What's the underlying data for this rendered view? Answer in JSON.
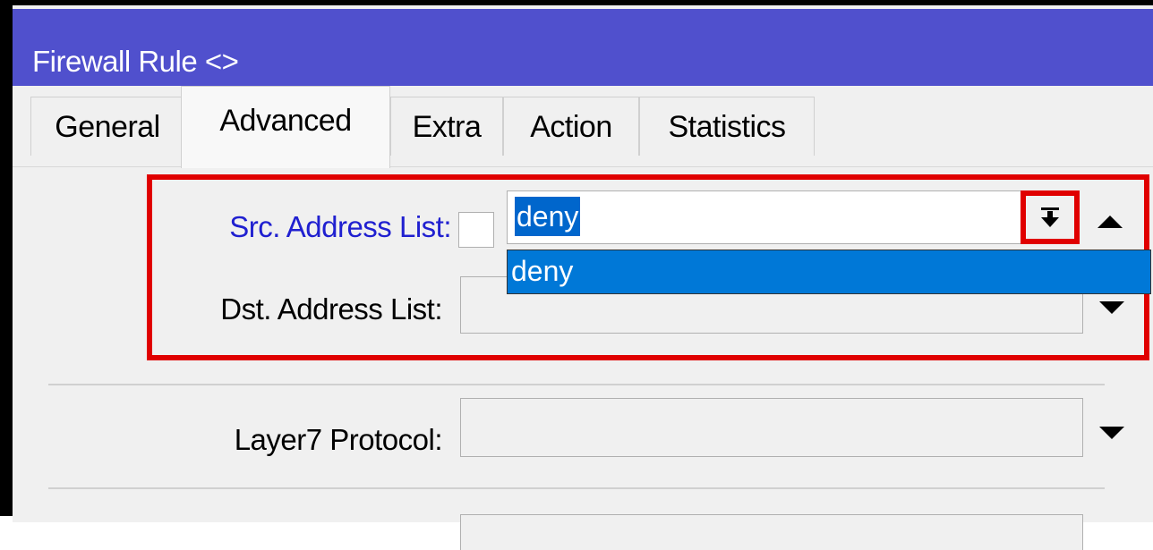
{
  "window": {
    "title": "Firewall Rule <>"
  },
  "tabs": [
    {
      "label": "General"
    },
    {
      "label": "Advanced",
      "active": true
    },
    {
      "label": "Extra"
    },
    {
      "label": "Action"
    },
    {
      "label": "Statistics"
    }
  ],
  "fields": {
    "src_address_list": {
      "label": "Src. Address List:",
      "value": "deny",
      "dropdown_options": [
        "deny"
      ]
    },
    "dst_address_list": {
      "label": "Dst. Address List:",
      "value": ""
    },
    "layer7_protocol": {
      "label": "Layer7 Protocol:",
      "value": ""
    }
  },
  "icons": {
    "combo_button": "insert-arrow-icon",
    "collapse": "arrow-up-icon",
    "expand": "arrow-down-icon"
  },
  "colors": {
    "titlebar": "#5050cd",
    "highlight": "#e00000",
    "selection": "#0078d7",
    "label_accent": "#2020d0"
  }
}
